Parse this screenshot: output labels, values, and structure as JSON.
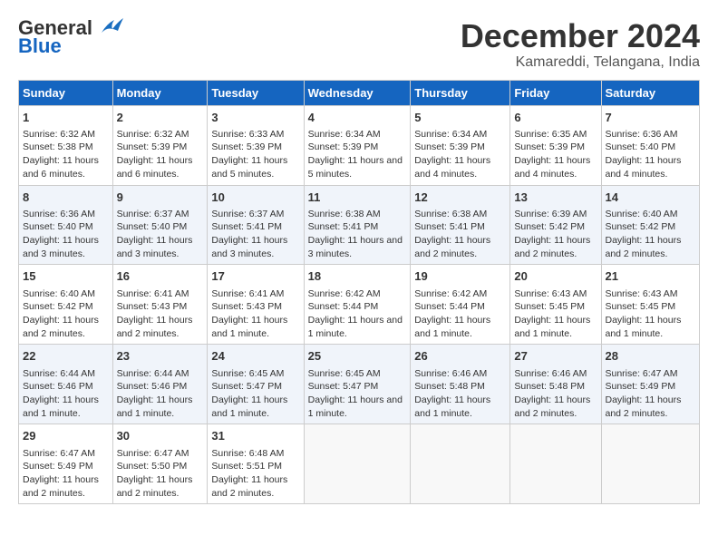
{
  "header": {
    "logo_general": "General",
    "logo_blue": "Blue",
    "main_title": "December 2024",
    "subtitle": "Kamareddi, Telangana, India"
  },
  "calendar": {
    "days_of_week": [
      "Sunday",
      "Monday",
      "Tuesday",
      "Wednesday",
      "Thursday",
      "Friday",
      "Saturday"
    ],
    "weeks": [
      [
        null,
        null,
        null,
        null,
        null,
        null,
        null
      ]
    ],
    "cells": [
      [
        {
          "day": null
        },
        {
          "day": null
        },
        {
          "day": null
        },
        {
          "day": null
        },
        {
          "day": null
        },
        {
          "day": null
        },
        {
          "day": null
        }
      ]
    ]
  },
  "days": {
    "w1": [
      {
        "num": "1",
        "sunrise": "6:32 AM",
        "sunset": "5:38 PM",
        "daylight": "11 hours and 6 minutes."
      },
      {
        "num": "2",
        "sunrise": "6:32 AM",
        "sunset": "5:39 PM",
        "daylight": "11 hours and 6 minutes."
      },
      {
        "num": "3",
        "sunrise": "6:33 AM",
        "sunset": "5:39 PM",
        "daylight": "11 hours and 5 minutes."
      },
      {
        "num": "4",
        "sunrise": "6:34 AM",
        "sunset": "5:39 PM",
        "daylight": "11 hours and 5 minutes."
      },
      {
        "num": "5",
        "sunrise": "6:34 AM",
        "sunset": "5:39 PM",
        "daylight": "11 hours and 4 minutes."
      },
      {
        "num": "6",
        "sunrise": "6:35 AM",
        "sunset": "5:39 PM",
        "daylight": "11 hours and 4 minutes."
      },
      {
        "num": "7",
        "sunrise": "6:36 AM",
        "sunset": "5:40 PM",
        "daylight": "11 hours and 4 minutes."
      }
    ],
    "w2": [
      {
        "num": "8",
        "sunrise": "6:36 AM",
        "sunset": "5:40 PM",
        "daylight": "11 hours and 3 minutes."
      },
      {
        "num": "9",
        "sunrise": "6:37 AM",
        "sunset": "5:40 PM",
        "daylight": "11 hours and 3 minutes."
      },
      {
        "num": "10",
        "sunrise": "6:37 AM",
        "sunset": "5:41 PM",
        "daylight": "11 hours and 3 minutes."
      },
      {
        "num": "11",
        "sunrise": "6:38 AM",
        "sunset": "5:41 PM",
        "daylight": "11 hours and 3 minutes."
      },
      {
        "num": "12",
        "sunrise": "6:38 AM",
        "sunset": "5:41 PM",
        "daylight": "11 hours and 2 minutes."
      },
      {
        "num": "13",
        "sunrise": "6:39 AM",
        "sunset": "5:42 PM",
        "daylight": "11 hours and 2 minutes."
      },
      {
        "num": "14",
        "sunrise": "6:40 AM",
        "sunset": "5:42 PM",
        "daylight": "11 hours and 2 minutes."
      }
    ],
    "w3": [
      {
        "num": "15",
        "sunrise": "6:40 AM",
        "sunset": "5:42 PM",
        "daylight": "11 hours and 2 minutes."
      },
      {
        "num": "16",
        "sunrise": "6:41 AM",
        "sunset": "5:43 PM",
        "daylight": "11 hours and 2 minutes."
      },
      {
        "num": "17",
        "sunrise": "6:41 AM",
        "sunset": "5:43 PM",
        "daylight": "11 hours and 1 minute."
      },
      {
        "num": "18",
        "sunrise": "6:42 AM",
        "sunset": "5:44 PM",
        "daylight": "11 hours and 1 minute."
      },
      {
        "num": "19",
        "sunrise": "6:42 AM",
        "sunset": "5:44 PM",
        "daylight": "11 hours and 1 minute."
      },
      {
        "num": "20",
        "sunrise": "6:43 AM",
        "sunset": "5:45 PM",
        "daylight": "11 hours and 1 minute."
      },
      {
        "num": "21",
        "sunrise": "6:43 AM",
        "sunset": "5:45 PM",
        "daylight": "11 hours and 1 minute."
      }
    ],
    "w4": [
      {
        "num": "22",
        "sunrise": "6:44 AM",
        "sunset": "5:46 PM",
        "daylight": "11 hours and 1 minute."
      },
      {
        "num": "23",
        "sunrise": "6:44 AM",
        "sunset": "5:46 PM",
        "daylight": "11 hours and 1 minute."
      },
      {
        "num": "24",
        "sunrise": "6:45 AM",
        "sunset": "5:47 PM",
        "daylight": "11 hours and 1 minute."
      },
      {
        "num": "25",
        "sunrise": "6:45 AM",
        "sunset": "5:47 PM",
        "daylight": "11 hours and 1 minute."
      },
      {
        "num": "26",
        "sunrise": "6:46 AM",
        "sunset": "5:48 PM",
        "daylight": "11 hours and 1 minute."
      },
      {
        "num": "27",
        "sunrise": "6:46 AM",
        "sunset": "5:48 PM",
        "daylight": "11 hours and 2 minutes."
      },
      {
        "num": "28",
        "sunrise": "6:47 AM",
        "sunset": "5:49 PM",
        "daylight": "11 hours and 2 minutes."
      }
    ],
    "w5": [
      {
        "num": "29",
        "sunrise": "6:47 AM",
        "sunset": "5:49 PM",
        "daylight": "11 hours and 2 minutes."
      },
      {
        "num": "30",
        "sunrise": "6:47 AM",
        "sunset": "5:50 PM",
        "daylight": "11 hours and 2 minutes."
      },
      {
        "num": "31",
        "sunrise": "6:48 AM",
        "sunset": "5:51 PM",
        "daylight": "11 hours and 2 minutes."
      },
      null,
      null,
      null,
      null
    ]
  }
}
